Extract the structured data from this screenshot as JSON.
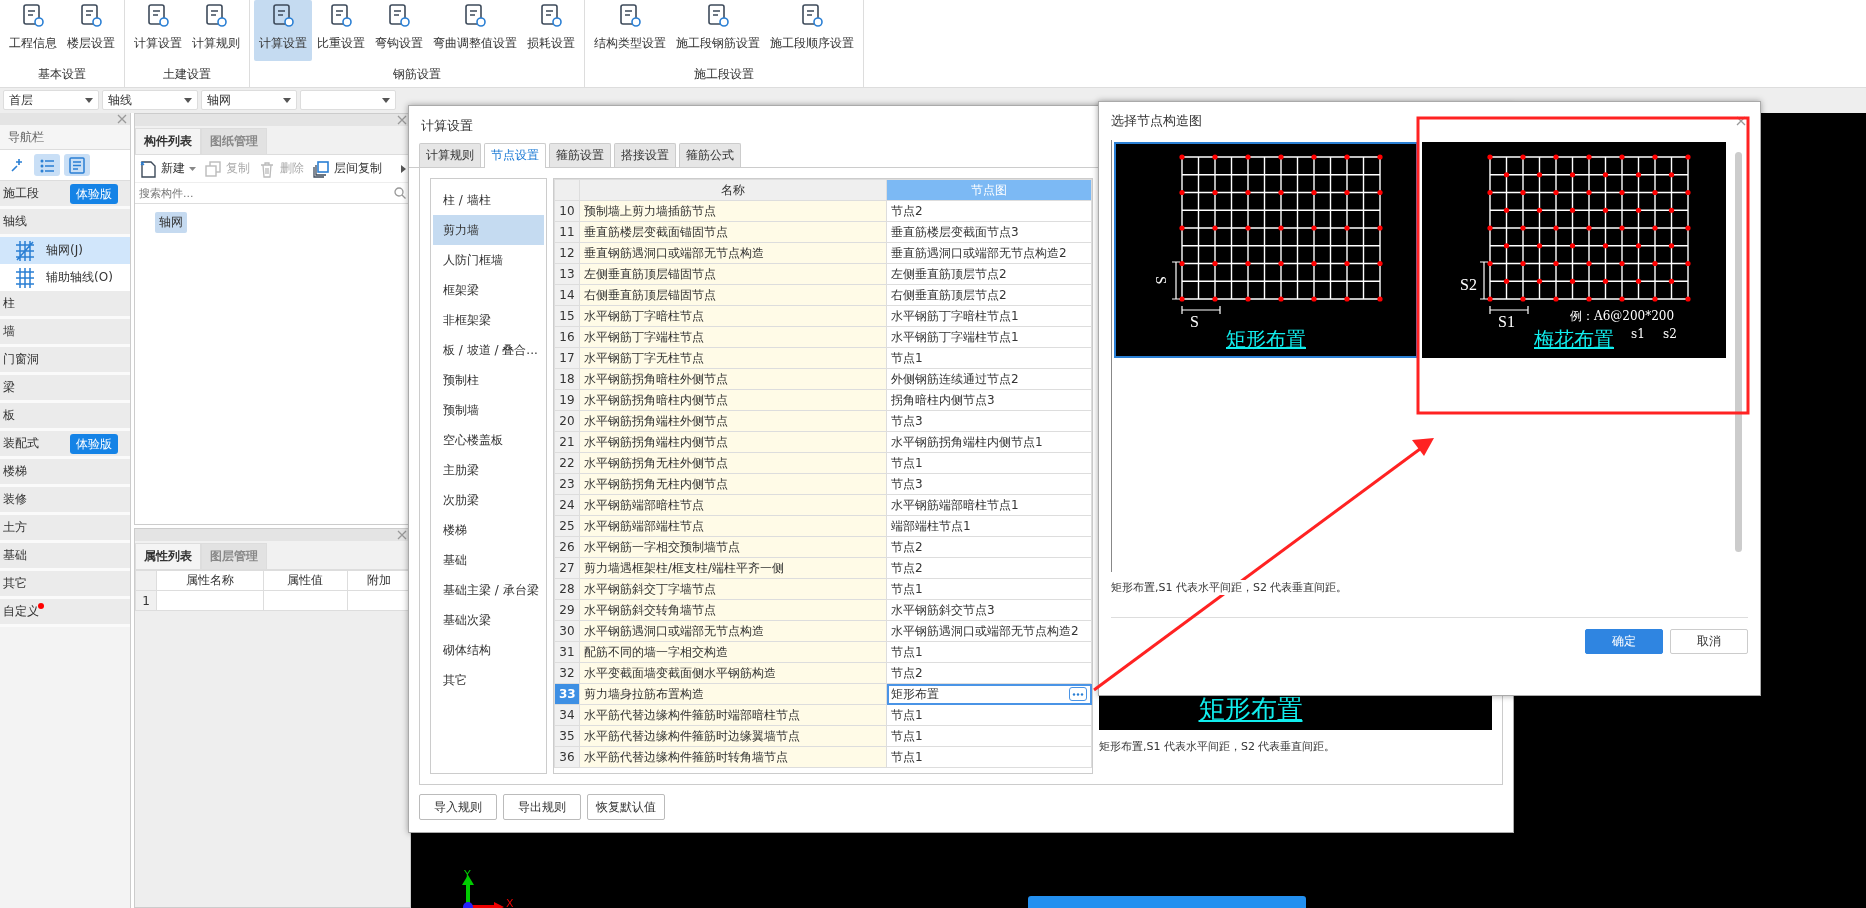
{
  "ribbon": {
    "groups": [
      {
        "label": "基本设置",
        "items": [
          {
            "label": "工程信息",
            "selected": false
          },
          {
            "label": "楼层设置",
            "selected": false
          }
        ]
      },
      {
        "label": "土建设置",
        "items": [
          {
            "label": "计算设置",
            "selected": false
          },
          {
            "label": "计算规则",
            "selected": false
          }
        ]
      },
      {
        "label": "钢筋设置",
        "items": [
          {
            "label": "计算设置",
            "selected": true
          },
          {
            "label": "比重设置",
            "selected": false
          },
          {
            "label": "弯钩设置",
            "selected": false
          },
          {
            "label": "弯曲调整值设置",
            "selected": false
          },
          {
            "label": "损耗设置",
            "selected": false
          }
        ]
      },
      {
        "label": "施工段设置",
        "items": [
          {
            "label": "结构类型设置",
            "selected": false
          },
          {
            "label": "施工段钢筋设置",
            "selected": false
          },
          {
            "label": "施工段顺序设置",
            "selected": false
          }
        ]
      }
    ]
  },
  "dropdowns": [
    {
      "kind": "select",
      "value": "首层"
    },
    {
      "kind": "select",
      "value": "轴线"
    },
    {
      "kind": "select",
      "value": "轴网"
    },
    {
      "kind": "select"
    }
  ],
  "nav": {
    "title": "导航栏",
    "view_buttons": [
      {
        "kind": "pin",
        "selected": false
      },
      {
        "kind": "list",
        "selected": true
      },
      {
        "kind": "detail",
        "selected": true
      }
    ],
    "items": [
      {
        "label": "施工段",
        "badge": "体验版",
        "dot": false
      },
      {
        "label": "轴线",
        "dot": false,
        "children": [
          {
            "label": "轴网(J)",
            "kind": "grid",
            "selected": true
          },
          {
            "label": "辅助轴线(O)",
            "kind": "aux",
            "selected": false
          }
        ]
      },
      {
        "label": "柱",
        "dot": false
      },
      {
        "label": "墙",
        "dot": false
      },
      {
        "label": "门窗洞",
        "dot": false
      },
      {
        "label": "梁",
        "dot": false
      },
      {
        "label": "板",
        "dot": false
      },
      {
        "label": "装配式",
        "badge": "体验版",
        "dot": false
      },
      {
        "label": "楼梯",
        "dot": false
      },
      {
        "label": "装修",
        "dot": false
      },
      {
        "label": "土方",
        "dot": false
      },
      {
        "label": "基础",
        "dot": false
      },
      {
        "label": "其它",
        "dot": false
      },
      {
        "label": "自定义",
        "dot": true
      }
    ]
  },
  "components": {
    "tabs": [
      {
        "label": "构件列表",
        "selected": true
      },
      {
        "label": "图纸管理",
        "selected": false
      }
    ],
    "toolbar": [
      {
        "label": "新建",
        "kind": "new",
        "disabled": false
      },
      {
        "label": "复制",
        "kind": "copy",
        "disabled": true
      },
      {
        "label": "删除",
        "kind": "delete",
        "disabled": true
      },
      {
        "label": "层间复制",
        "kind": "floor-copy",
        "disabled": false
      }
    ],
    "search": {
      "placeholder": "搜索构件..."
    },
    "tree": [
      {
        "label": "轴网",
        "selected": true
      }
    ]
  },
  "properties": {
    "tabs": [
      {
        "label": "属性列表",
        "selected": true
      },
      {
        "label": "图层管理",
        "selected": false
      }
    ],
    "columns": [
      "属性名称",
      "属性值",
      "附加"
    ],
    "rows": [
      {
        "index": "1"
      }
    ]
  },
  "canvas": {
    "axis_labels": [
      "Y",
      "X"
    ]
  },
  "calc_dialog": {
    "title": "计算设置",
    "tabs": [
      {
        "label": "计算规则",
        "selected": false
      },
      {
        "label": "节点设置",
        "selected": true
      },
      {
        "label": "箍筋设置",
        "selected": false
      },
      {
        "label": "搭接设置",
        "selected": false
      },
      {
        "label": "箍筋公式",
        "selected": false
      }
    ],
    "categories": [
      {
        "label": "柱 / 墙柱",
        "selected": false
      },
      {
        "label": "剪力墙",
        "selected": true
      },
      {
        "label": "人防门框墙",
        "selected": false
      },
      {
        "label": "框架梁",
        "selected": false
      },
      {
        "label": "非框架梁",
        "selected": false
      },
      {
        "label": "板 / 坡道 / 叠合...",
        "selected": false
      },
      {
        "label": "预制柱",
        "selected": false
      },
      {
        "label": "预制墙",
        "selected": false
      },
      {
        "label": "空心楼盖板",
        "selected": false
      },
      {
        "label": "主肋梁",
        "selected": false
      },
      {
        "label": "次肋梁",
        "selected": false
      },
      {
        "label": "楼梯",
        "selected": false
      },
      {
        "label": "基础",
        "selected": false
      },
      {
        "label": "基础主梁 / 承台梁",
        "selected": false
      },
      {
        "label": "基础次梁",
        "selected": false
      },
      {
        "label": "砌体结构",
        "selected": false
      },
      {
        "label": "其它",
        "selected": false
      }
    ],
    "columns": [
      {
        "label": "名称",
        "selected": false
      },
      {
        "label": "节点图",
        "selected": true
      }
    ],
    "rows": [
      {
        "number": "10",
        "name": "预制墙上剪力墙插筋节点",
        "node": "节点2",
        "selected": false
      },
      {
        "number": "11",
        "name": "垂直筋楼层变截面锚固节点",
        "node": "垂直筋楼层变截面节点3",
        "selected": false
      },
      {
        "number": "12",
        "name": "垂直钢筋遇洞口或端部无节点构造",
        "node": "垂直筋遇洞口或端部无节点构造2",
        "selected": false
      },
      {
        "number": "13",
        "name": "左侧垂直筋顶层锚固节点",
        "node": "左侧垂直筋顶层节点2",
        "selected": false
      },
      {
        "number": "14",
        "name": "右侧垂直筋顶层锚固节点",
        "node": "右侧垂直筋顶层节点2",
        "selected": false
      },
      {
        "number": "15",
        "name": "水平钢筋丁字暗柱节点",
        "node": "水平钢筋丁字暗柱节点1",
        "selected": false
      },
      {
        "number": "16",
        "name": "水平钢筋丁字端柱节点",
        "node": "水平钢筋丁字端柱节点1",
        "selected": false
      },
      {
        "number": "17",
        "name": "水平钢筋丁字无柱节点",
        "node": "节点1",
        "selected": false
      },
      {
        "number": "18",
        "name": "水平钢筋拐角暗柱外侧节点",
        "node": "外侧钢筋连续通过节点2",
        "selected": false
      },
      {
        "number": "19",
        "name": "水平钢筋拐角暗柱内侧节点",
        "node": "拐角暗柱内侧节点3",
        "selected": false
      },
      {
        "number": "20",
        "name": "水平钢筋拐角端柱外侧节点",
        "node": "节点3",
        "selected": false
      },
      {
        "number": "21",
        "name": "水平钢筋拐角端柱内侧节点",
        "node": "水平钢筋拐角端柱内侧节点1",
        "selected": false
      },
      {
        "number": "22",
        "name": "水平钢筋拐角无柱外侧节点",
        "node": "节点1",
        "selected": false
      },
      {
        "number": "23",
        "name": "水平钢筋拐角无柱内侧节点",
        "node": "节点3",
        "selected": false
      },
      {
        "number": "24",
        "name": "水平钢筋端部暗柱节点",
        "node": "水平钢筋端部暗柱节点1",
        "selected": false
      },
      {
        "number": "25",
        "name": "水平钢筋端部端柱节点",
        "node": "端部端柱节点1",
        "selected": false
      },
      {
        "number": "26",
        "name": "水平钢筋一字相交预制墙节点",
        "node": "节点2",
        "selected": false
      },
      {
        "number": "27",
        "name": "剪力墙遇框架柱/框支柱/端柱平齐一侧",
        "node": "节点2",
        "selected": false
      },
      {
        "number": "28",
        "name": "水平钢筋斜交丁字墙节点",
        "node": "节点1",
        "selected": false
      },
      {
        "number": "29",
        "name": "水平钢筋斜交转角墙节点",
        "node": "水平钢筋斜交节点3",
        "selected": false
      },
      {
        "number": "30",
        "name": "水平钢筋遇洞口或端部无节点构造",
        "node": "水平钢筋遇洞口或端部无节点构造2",
        "selected": false
      },
      {
        "number": "31",
        "name": "配筋不同的墙一字相交构造",
        "node": "节点1",
        "selected": false
      },
      {
        "number": "32",
        "name": "水平变截面墙变截面侧水平钢筋构造",
        "node": "节点2",
        "selected": false
      },
      {
        "number": "33",
        "name": "剪力墙身拉筋布置构造",
        "node": "矩形布置",
        "selected": true
      },
      {
        "number": "34",
        "name": "水平筋代替边缘构件箍筋时端部暗柱节点",
        "node": "节点1",
        "selected": false
      },
      {
        "number": "35",
        "name": "水平筋代替边缘构件箍筋时边缘翼墙节点",
        "node": "节点1",
        "selected": false
      },
      {
        "number": "36",
        "name": "水平筋代替边缘构件箍筋时转角墙节点",
        "node": "节点1",
        "selected": false
      }
    ],
    "preview": {
      "caption": "矩形布置",
      "description": "矩形布置,S1 代表水平间距，S2 代表垂直间距。"
    },
    "buttons": [
      "导入规则",
      "导出规则",
      "恢复默认值"
    ]
  },
  "node_dialog": {
    "title": "选择节点构造图",
    "options": [
      {
        "kind": "rect",
        "caption": "矩形布置",
        "selected": true,
        "dims": [
          "S",
          "S"
        ]
      },
      {
        "kind": "quincunx",
        "caption": "梅花布置",
        "selected": false,
        "dims": [
          "S2",
          "S1"
        ],
        "note": "例：A6@200*200",
        "note_marks": [
          "s1",
          "s2"
        ]
      }
    ],
    "description": "矩形布置,S1 代表水平间距，S2 代表垂直间距。",
    "buttons": [
      {
        "label": "确定",
        "primary": true
      },
      {
        "label": "取消",
        "primary": false
      }
    ]
  }
}
